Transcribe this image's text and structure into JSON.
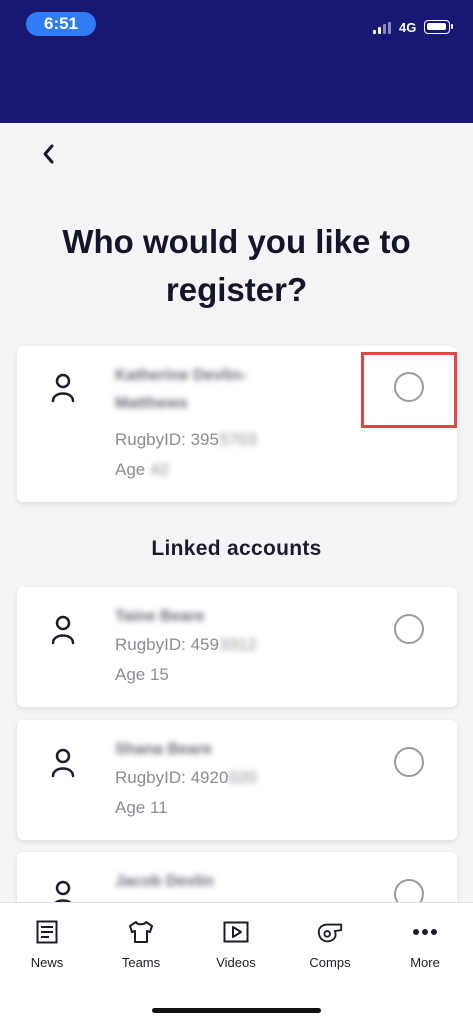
{
  "status_bar": {
    "time": "6:51",
    "network": "4G"
  },
  "page": {
    "title": "Who would you like to register?"
  },
  "primary_account": {
    "name_line1": "Katherine Devlin-",
    "name_line2": "Matthews",
    "rugby_id_label": "RugbyID: 395",
    "rugby_id_hidden": "5703",
    "age_label": "Age",
    "age_hidden": "42"
  },
  "linked_section": {
    "title": "Linked accounts"
  },
  "linked_accounts": [
    {
      "name": "Taine Beare",
      "rugby_id_label": "RugbyID: 459",
      "rugby_id_hidden": "3312",
      "age": "Age 15"
    },
    {
      "name": "Shana Beare",
      "rugby_id_label": "RugbyID: 4920",
      "rugby_id_hidden": "020",
      "age": "Age 11"
    },
    {
      "name": "Jacob Devlin"
    }
  ],
  "tabs": [
    {
      "label": "News",
      "icon": "news-icon"
    },
    {
      "label": "Teams",
      "icon": "jersey-icon"
    },
    {
      "label": "Videos",
      "icon": "video-icon"
    },
    {
      "label": "Comps",
      "icon": "whistle-icon"
    },
    {
      "label": "More",
      "icon": "more-icon"
    }
  ],
  "colors": {
    "header": "#181873",
    "time_pill": "#2f7cf6",
    "highlight": "#e54545"
  }
}
